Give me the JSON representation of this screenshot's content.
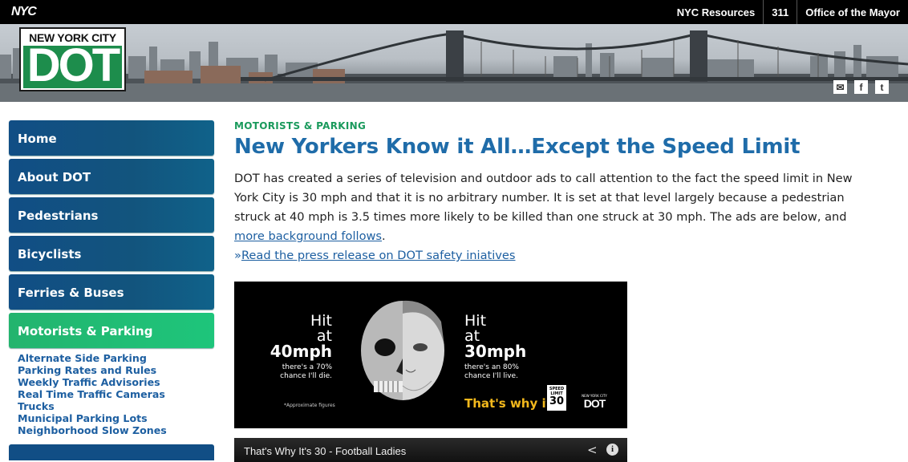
{
  "topbar": {
    "logo": "NYC",
    "links": [
      "NYC Resources",
      "311",
      "Office of the Mayor"
    ]
  },
  "header": {
    "logo_title": "NEW YORK CITY",
    "logo_mark": "DOT",
    "social": [
      "email-icon",
      "facebook-icon",
      "twitter-icon"
    ]
  },
  "sidebar": {
    "items": [
      {
        "label": "Home"
      },
      {
        "label": "About DOT"
      },
      {
        "label": "Pedestrians"
      },
      {
        "label": "Bicyclists"
      },
      {
        "label": "Ferries & Buses"
      },
      {
        "label": "Motorists & Parking",
        "active": true
      }
    ],
    "subitems": [
      "Alternate Side Parking",
      "Parking Rates and Rules",
      "Weekly Traffic Advisories",
      "Real Time Traffic Cameras",
      "Trucks",
      "Municipal Parking Lots",
      "Neighborhood Slow Zones"
    ]
  },
  "main": {
    "section": "MOTORISTS & PARKING",
    "title": "New Yorkers Know it All…Except the Speed Limit",
    "intro": "DOT has created a series of television and outdoor ads to call attention to the fact the speed limit in New York City is 30 mph and that it is no arbitrary number. It is set at that level largely because a pedestrian struck at 40 mph is 3.5 times more likely to be killed than one struck at 30 mph. The ads are below, and ",
    "intro_link": "more background follows",
    "intro_end": ".",
    "press_prefix": "»",
    "press_link": "Read the press release on DOT safety iniatives",
    "ad": {
      "left_hit": "Hit",
      "left_at": "at",
      "left_speed": "40mph",
      "left_line1": "there's a 70%",
      "left_line2": "chance I'll die.",
      "approx": "*Approximate figures",
      "right_hit": "Hit",
      "right_at": "at",
      "right_speed": "30mph",
      "right_line1": "there's an 80%",
      "right_line2": "chance I'll live.",
      "tagline": "That's why it's",
      "sign_label": "SPEED LIMIT",
      "sign_value": "30",
      "logo_title": "NEW YORK CITY",
      "logo_mark": "DOT"
    },
    "video": {
      "title": "That's Why It's 30 - Football Ladies"
    }
  }
}
